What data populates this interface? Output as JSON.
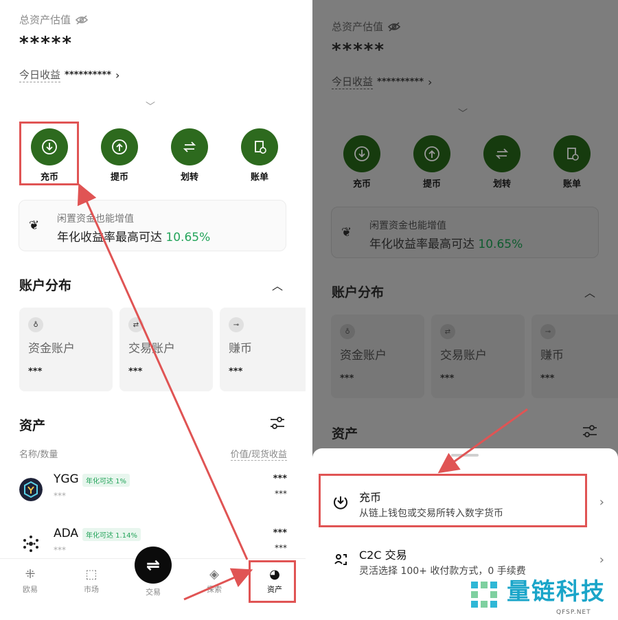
{
  "left": {
    "total_label": "总资产估值",
    "total_value": "*****",
    "today_label": "今日收益",
    "today_value": "**********",
    "actions": [
      {
        "label": "充币",
        "icon": "deposit-icon"
      },
      {
        "label": "提币",
        "icon": "withdraw-icon"
      },
      {
        "label": "划转",
        "icon": "transfer-icon"
      },
      {
        "label": "账单",
        "icon": "bill-icon"
      }
    ],
    "promo": {
      "title": "闲置资金也能增值",
      "text": "年化收益率最高可达",
      "rate": "10.65%"
    },
    "account_title": "账户分布",
    "accounts": [
      {
        "name": "资金账户",
        "value": "***",
        "icon": "fund-icon"
      },
      {
        "name": "交易账户",
        "value": "***",
        "icon": "trade-account-icon"
      },
      {
        "name": "赚币",
        "value": "***",
        "icon": "earn-icon"
      }
    ],
    "assets_title": "资产",
    "col_left": "名称/数量",
    "col_right": "价值/现货收益",
    "assets": [
      {
        "symbol": "YGG",
        "tag": "年化可达 1%",
        "sub": "***",
        "v1": "***",
        "v2": "***"
      },
      {
        "symbol": "ADA",
        "tag": "年化可达 1.14%",
        "sub": "***",
        "v1": "***",
        "v2": "***"
      }
    ],
    "nav": [
      {
        "label": "欧易",
        "icon": "okx-icon"
      },
      {
        "label": "市场",
        "icon": "market-icon"
      },
      {
        "label": "交易",
        "icon": "trade-icon"
      },
      {
        "label": "探索",
        "icon": "explore-icon"
      },
      {
        "label": "资产",
        "icon": "assets-pie-icon"
      }
    ]
  },
  "right": {
    "total_label": "总资产估值",
    "total_value": "*****",
    "today_label": "今日收益",
    "today_value": "**********",
    "actions": [
      {
        "label": "充币"
      },
      {
        "label": "提币"
      },
      {
        "label": "划转"
      },
      {
        "label": "账单"
      }
    ],
    "promo": {
      "title": "闲置资金也能增值",
      "text": "年化收益率最高可达",
      "rate": "10.65%"
    },
    "account_title": "账户分布",
    "accounts": [
      {
        "name": "资金账户",
        "value": "***"
      },
      {
        "name": "交易账户",
        "value": "***"
      },
      {
        "name": "赚币",
        "value": "***"
      }
    ],
    "assets_title": "资产",
    "sheet": [
      {
        "title": "充币",
        "subtitle": "从链上钱包或交易所转入数字货币"
      },
      {
        "title": "C2C 交易",
        "subtitle": "灵活选择 100+ 收付款方式，0 手续费"
      }
    ]
  },
  "watermark": {
    "text": "量链科技",
    "sub": "QFSP.NET"
  },
  "colors": {
    "brand_green": "#2d6a1e",
    "rate_green": "#23a45a",
    "highlight_red": "#e05454",
    "watermark_blue": "#1aa5c9"
  }
}
